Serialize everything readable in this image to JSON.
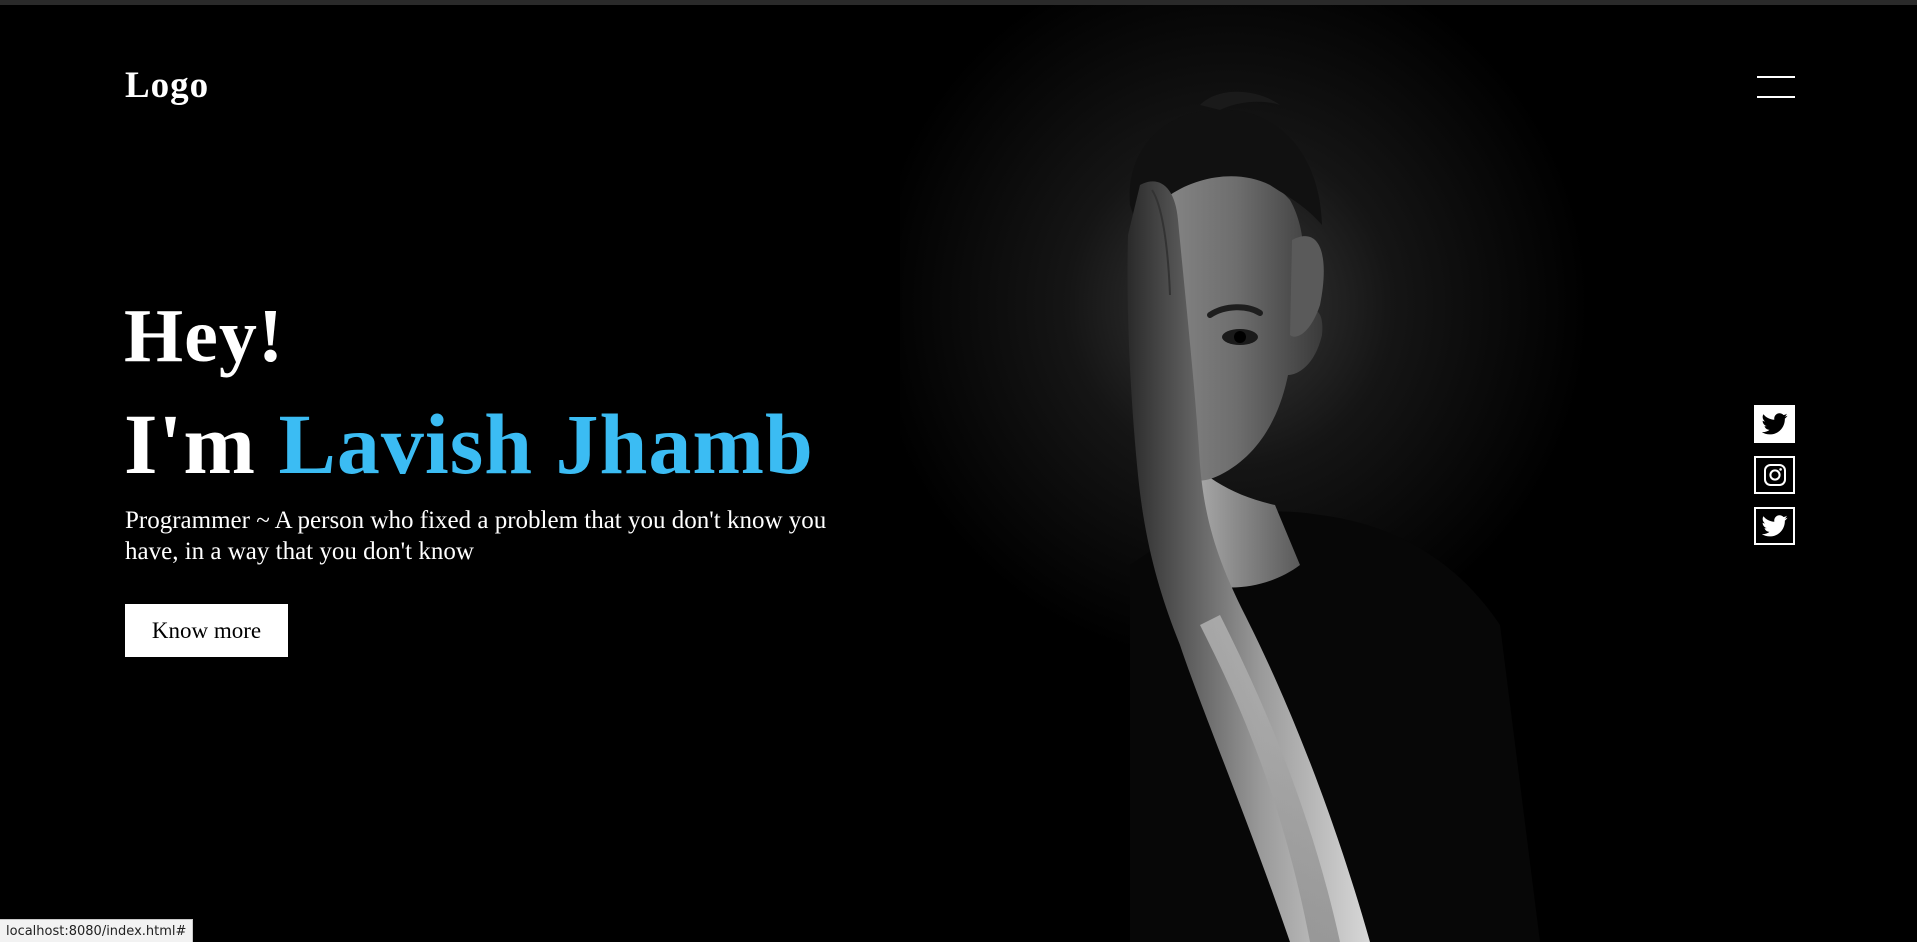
{
  "header": {
    "logo_text": "Logo",
    "menu_icon": "hamburger-menu-icon"
  },
  "hero": {
    "greeting": "Hey!",
    "intro_prefix": "I'm",
    "name": "Lavish Jhamb",
    "tagline": "Programmer ~ A person who fixed a problem that you don't know you have, in a way that you don't know",
    "cta_label": "Know more",
    "photo": "portrait-person-covering-half-face"
  },
  "social": [
    {
      "icon": "twitter-icon",
      "style": "filled"
    },
    {
      "icon": "instagram-icon",
      "style": "outlined"
    },
    {
      "icon": "twitter-icon",
      "style": "outlined"
    }
  ],
  "status_bar": {
    "url": "localhost:8080/index.html#"
  },
  "colors": {
    "background": "#000000",
    "text": "#ffffff",
    "accent": "#3bbcf3"
  }
}
